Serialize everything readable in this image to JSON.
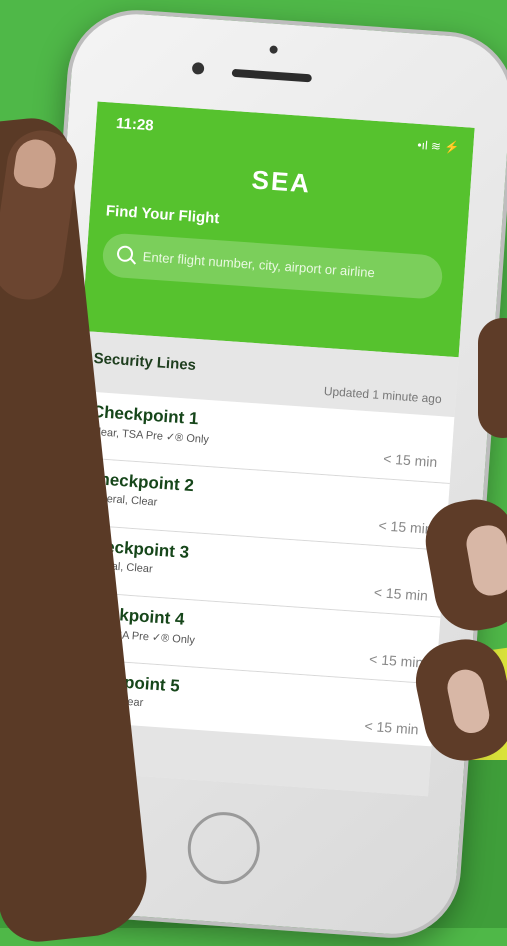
{
  "status": {
    "time": "11:28",
    "icons": "•ıl ≋ ⚡"
  },
  "header": {
    "logo": "SEA",
    "find_label": "Find Your Flight",
    "search_placeholder": "Enter flight number, city, airport or airline"
  },
  "security": {
    "title": "Security Lines",
    "updated": "Updated 1 minute ago"
  },
  "checkpoints": [
    {
      "name": "Checkpoint 1",
      "lanes": "Clear, TSA Pre ✓® Only",
      "wait": "< 15 min"
    },
    {
      "name": "Checkpoint 2",
      "lanes": "General, Clear",
      "wait": "< 15 min"
    },
    {
      "name": "Checkpoint 3",
      "lanes": "General, Clear",
      "wait": "< 15 min"
    },
    {
      "name": "Checkpoint 4",
      "lanes": "Clear, TSA Pre ✓® Only",
      "wait": "< 15 min"
    },
    {
      "name": "Checkpoint 5",
      "lanes": "General, Clear",
      "wait": "< 15 min"
    }
  ],
  "colors": {
    "brand_green": "#56c22e",
    "background": "#4fb848"
  }
}
